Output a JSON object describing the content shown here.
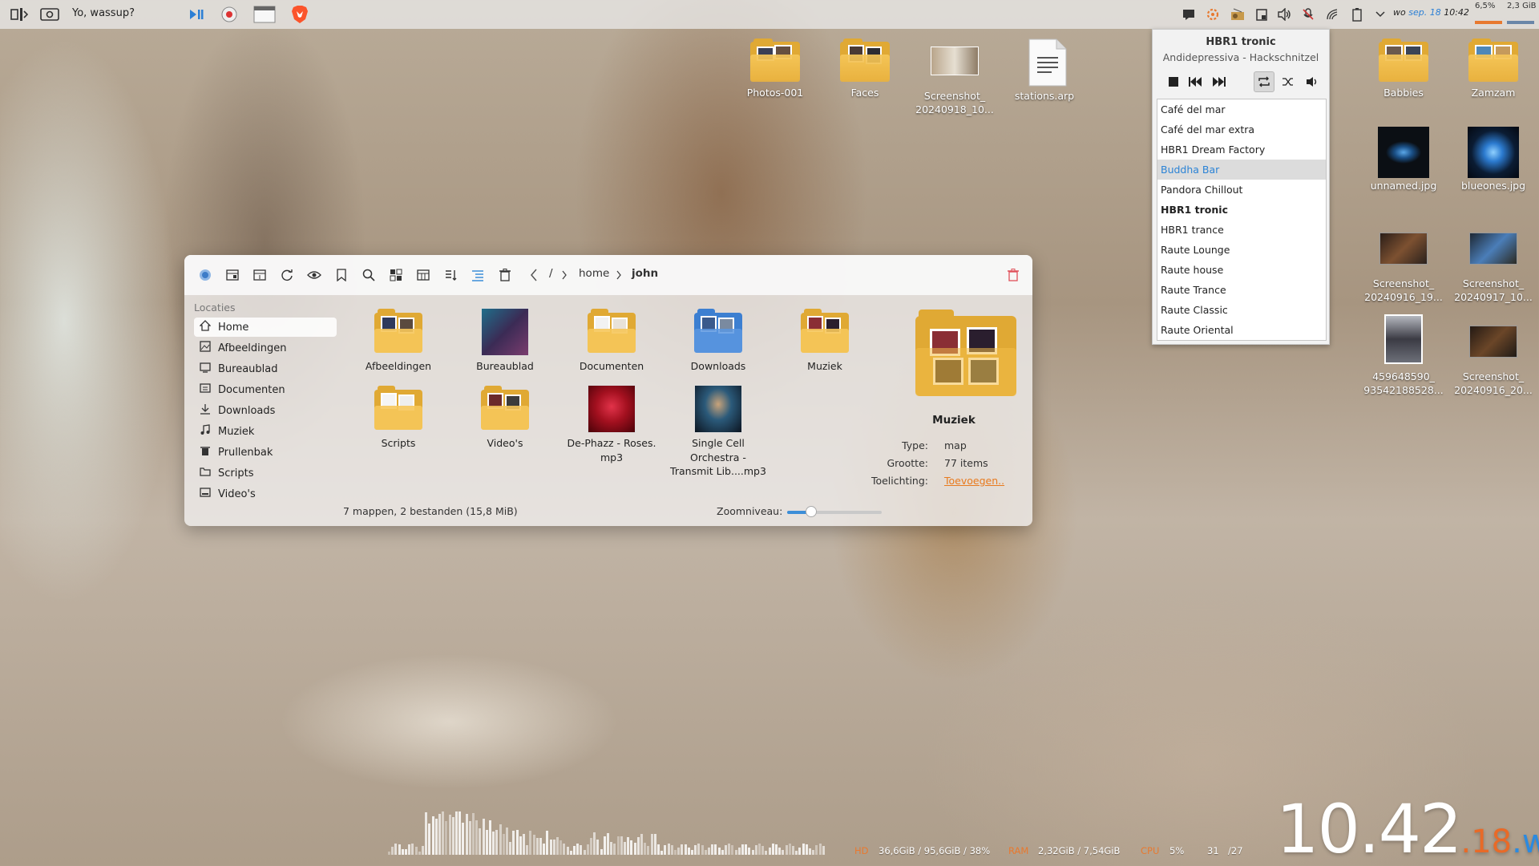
{
  "panel": {
    "greeting": "Yo, wassup?",
    "date": "wo",
    "date_accent": "sep. 18",
    "time": "10:42",
    "cpu": "6,5%",
    "ram": "2,3 GiB"
  },
  "desktop": {
    "icons_top": [
      {
        "label": "Photos-001"
      },
      {
        "label": "Faces"
      },
      {
        "label": "Screenshot_\n20240918_10..."
      },
      {
        "label": "stations.arp"
      }
    ],
    "icons_right": [
      {
        "label": "Babbies"
      },
      {
        "label": "Zamzam"
      },
      {
        "label": "unnamed.jpg"
      },
      {
        "label": "blueones.jpg"
      },
      {
        "label": "Screenshot_\n20240916_19..."
      },
      {
        "label": "Screenshot_\n20240917_10..."
      },
      {
        "label": "459648590_\n93542188528..."
      },
      {
        "label": "Screenshot_\n20240916_20..."
      }
    ]
  },
  "media_player": {
    "station": "HBR1 tronic",
    "track": "Andidepressiva - Hackschnitzel",
    "stations": [
      "Café del mar",
      "Café del mar extra",
      "HBR1 Dream Factory",
      "Buddha Bar",
      "Pandora Chillout",
      "HBR1 tronic",
      "HBR1 trance",
      "Raute Lounge",
      "Raute house",
      "Raute Trance",
      "Raute Classic",
      "Raute Oriental"
    ],
    "selected_index": 3,
    "playing_index": 5
  },
  "file_manager": {
    "breadcrumb": {
      "root": "/",
      "home": "home",
      "current": "john"
    },
    "sidebar": {
      "heading": "Locaties",
      "items": [
        {
          "label": "Home",
          "icon": "home-icon"
        },
        {
          "label": "Afbeeldingen",
          "icon": "image-icon"
        },
        {
          "label": "Bureaublad",
          "icon": "desktop-icon"
        },
        {
          "label": "Documenten",
          "icon": "document-icon"
        },
        {
          "label": "Downloads",
          "icon": "download-icon"
        },
        {
          "label": "Muziek",
          "icon": "music-icon"
        },
        {
          "label": "Prullenbak",
          "icon": "trash-icon"
        },
        {
          "label": "Scripts",
          "icon": "folder-icon"
        },
        {
          "label": "Video's",
          "icon": "video-icon"
        }
      ]
    },
    "files": [
      {
        "label": "Afbeeldingen"
      },
      {
        "label": "Bureaublad"
      },
      {
        "label": "Documenten"
      },
      {
        "label": "Downloads"
      },
      {
        "label": "Muziek"
      },
      {
        "label": "Scripts"
      },
      {
        "label": "Video's"
      },
      {
        "label": "De-Phazz - Roses.\nmp3"
      },
      {
        "label": "Single Cell\nOrchestra -\nTransmit Lib....mp3"
      }
    ],
    "status": "7 mappen, 2 bestanden (15,8 MiB)",
    "zoom_label": "Zoomniveau:",
    "zoom_level": 0.25,
    "info": {
      "name": "Muziek",
      "type_key": "Type:",
      "type_val": "map",
      "size_key": "Grootte:",
      "size_val": "77 items",
      "desc_key": "Toelichting:",
      "desc_val": "Toevoegen.."
    }
  },
  "stats": {
    "hd_label": "HD",
    "hd_val": "36,6GiB / 95,6GiB / 38%",
    "ram_label": "RAM",
    "ram_val": "2,32GiB / 7,54GiB",
    "cpu_label": "CPU",
    "cpu_val": "5%",
    "temp_a": "31",
    "temp_b": "/27"
  },
  "clock": {
    "time": "10.42",
    "seconds": ".18",
    "day": ".wo"
  },
  "colors": {
    "accent_orange": "#e8792f",
    "accent_blue": "#2b8ae0",
    "folder_yellow": "#e0a934"
  }
}
